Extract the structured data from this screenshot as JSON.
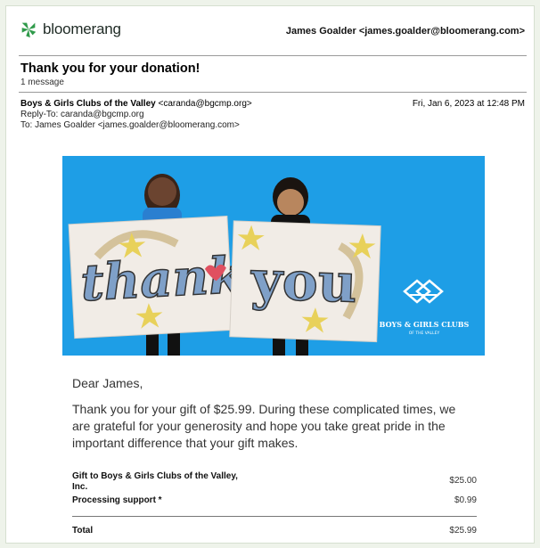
{
  "header": {
    "brand": "bloomerang",
    "account": "James Goalder <james.goalder@bloomerang.com>"
  },
  "email": {
    "subject": "Thank you for your donation!",
    "message_count": "1 message",
    "from_name": "Boys & Girls Clubs of the Valley",
    "from_email": "<caranda@bgcmp.org>",
    "date": "Fri, Jan 6, 2023 at 12:48 PM",
    "reply_to": "Reply-To: caranda@bgcmp.org",
    "to": "To: James Goalder <james.goalder@bloomerang.com>"
  },
  "hero": {
    "sign_left": "thank",
    "sign_right": "you",
    "org_logo_line1": "BOYS & GIRLS CLUBS",
    "org_logo_line2": "OF THE VALLEY"
  },
  "body": {
    "greeting": "Dear James,",
    "paragraph": "Thank you for your gift of $25.99.  During these complicated times, we are grateful for your generosity and hope you take great pride in the important difference that your gift makes."
  },
  "items": [
    {
      "label": "Gift to Boys & Girls Clubs of the Valley, Inc.",
      "amount": "$25.00"
    },
    {
      "label": "Processing support *",
      "amount": "$0.99"
    }
  ],
  "total": {
    "label": "Total",
    "amount": "$25.99"
  },
  "colors": {
    "brand_green": "#2f9a4a",
    "hero_blue": "#1e9ee6"
  }
}
